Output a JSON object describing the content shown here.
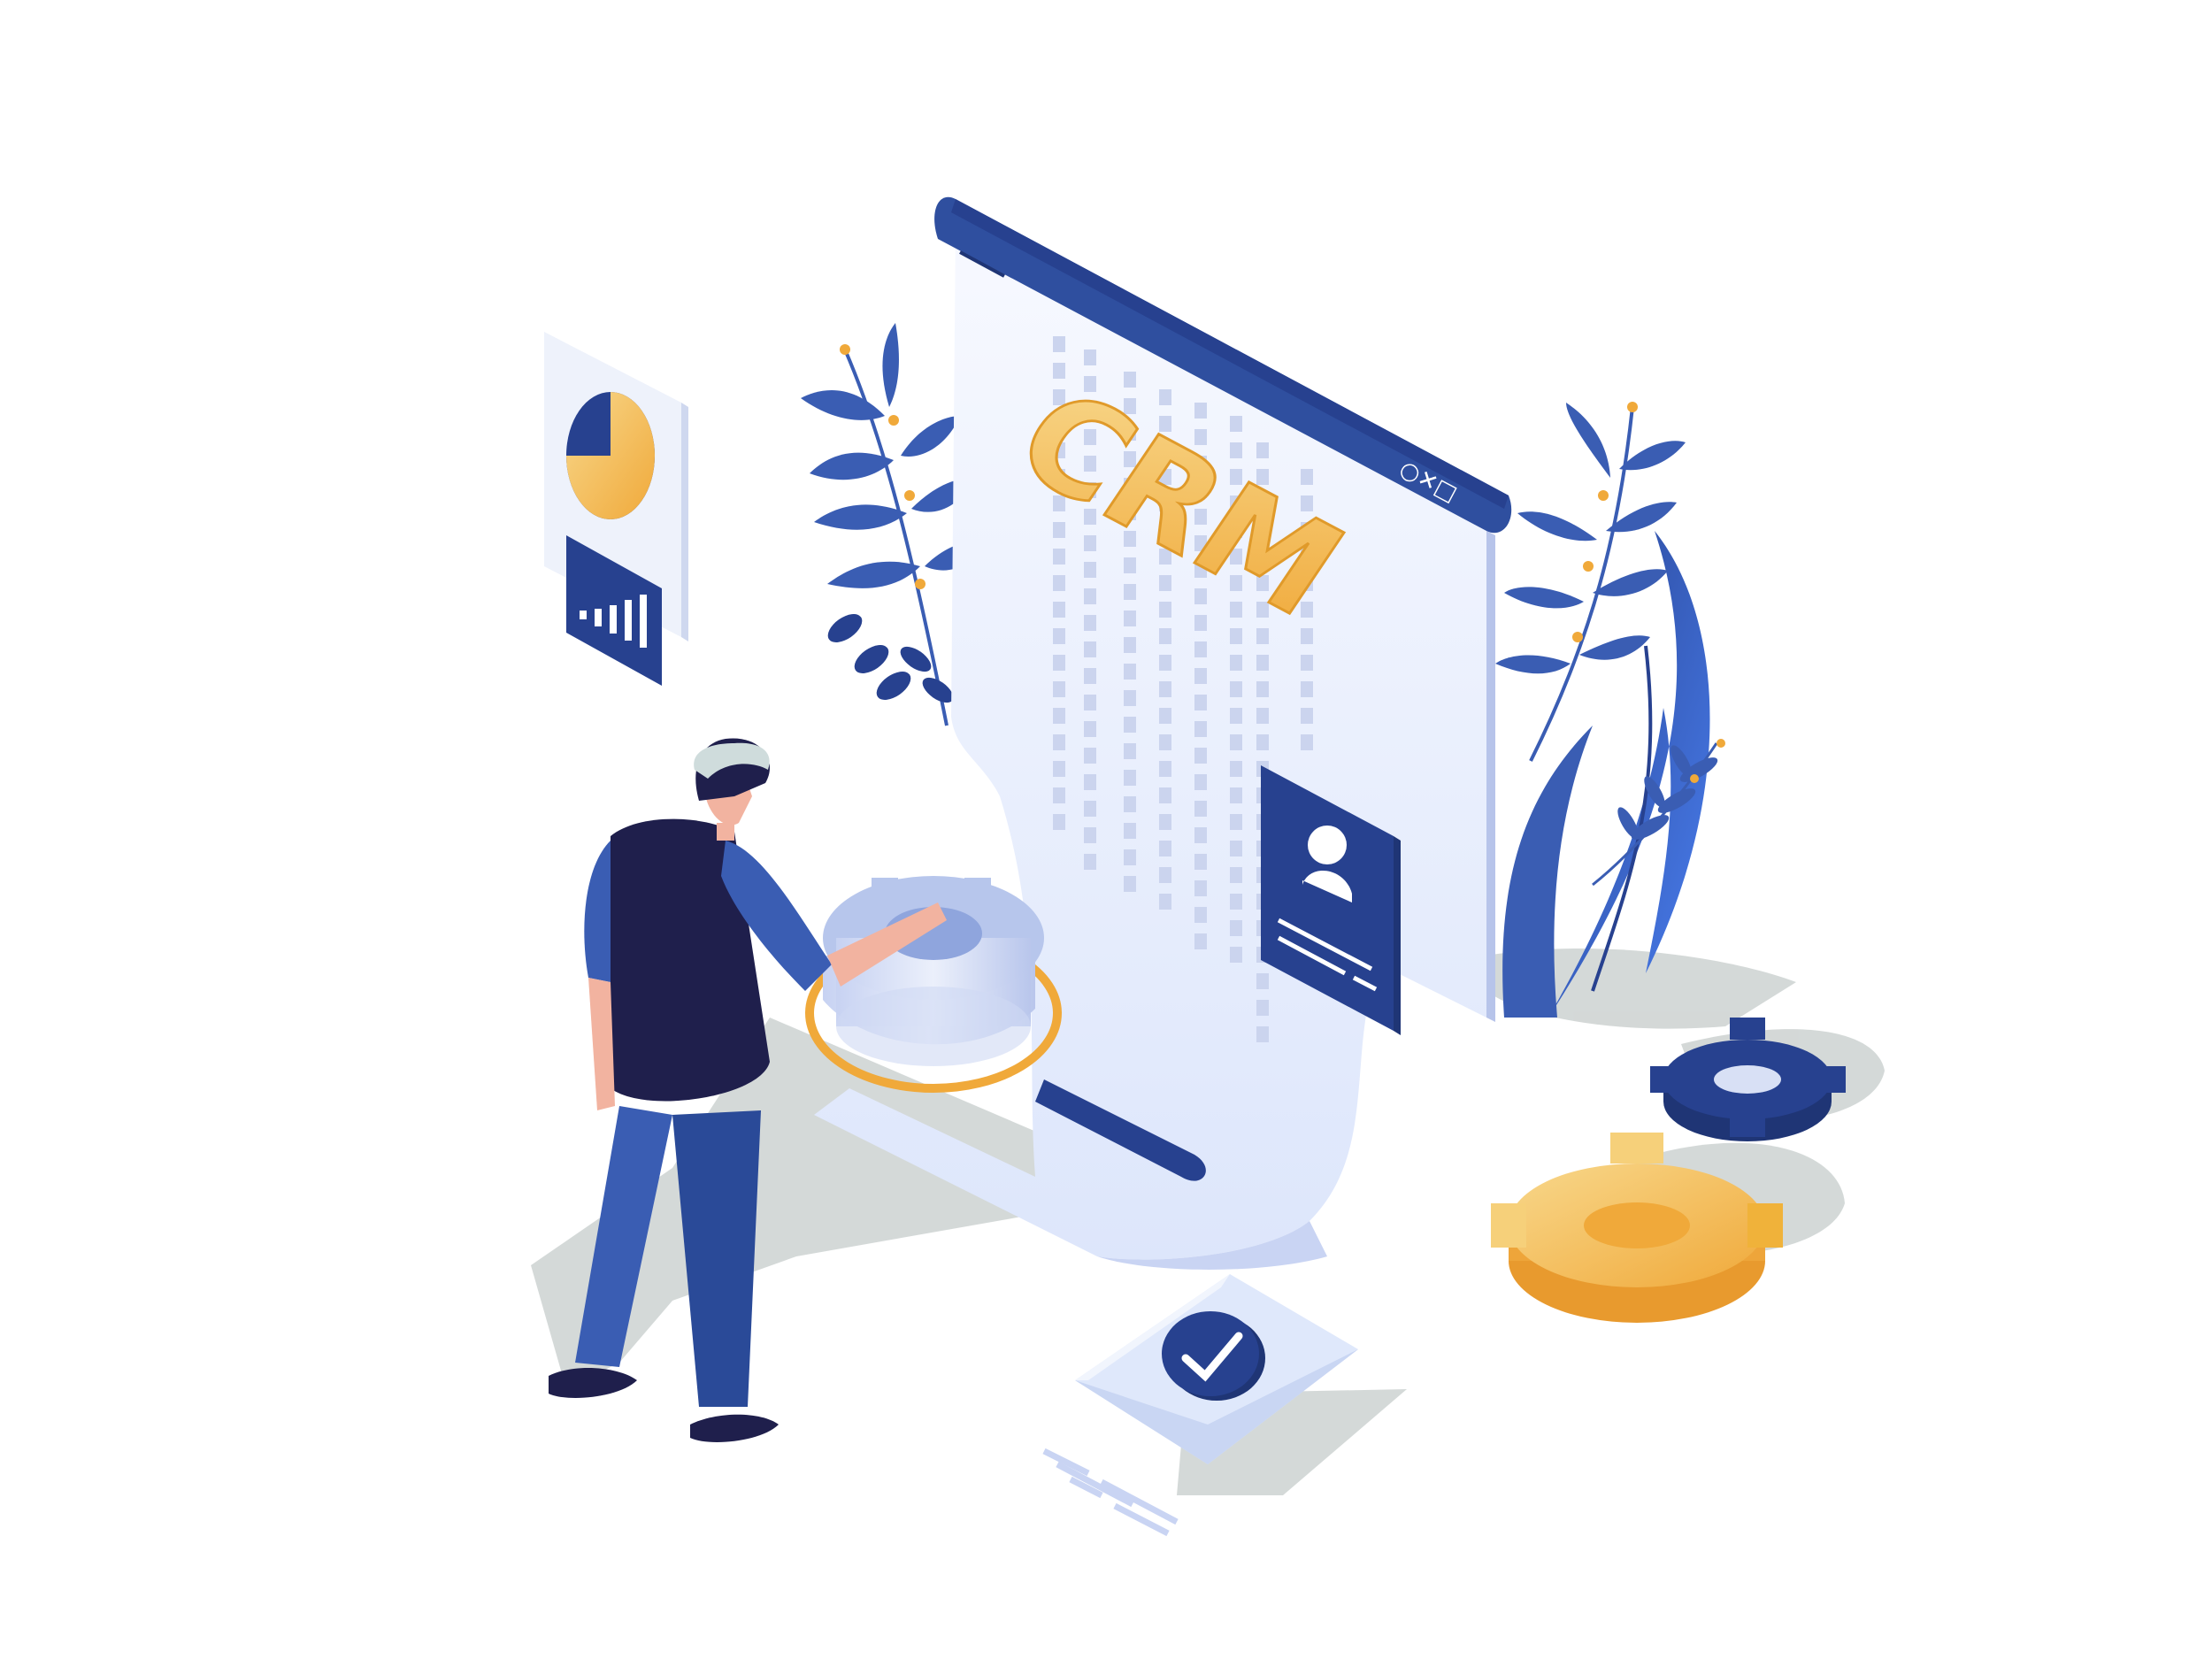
{
  "illustration": {
    "heading": "CRM",
    "window_controls": "○✕□"
  },
  "colors": {
    "navy": "#27418f",
    "dark_navy": "#1f1f4c",
    "blue": "#3a5db3",
    "light_blue": "#dfe8fb",
    "gold": "#f0b23a",
    "light_gold": "#f6d07a",
    "shadow": "#c9cecd",
    "skin": "#f2b3a0",
    "hair": "#cfdcdc"
  },
  "icons": [
    "pie-chart-icon",
    "bar-chart-icon",
    "user-profile-icon",
    "gear-icon",
    "magnifier-icon",
    "checkmark-icon",
    "leaf-plant-icon"
  ]
}
